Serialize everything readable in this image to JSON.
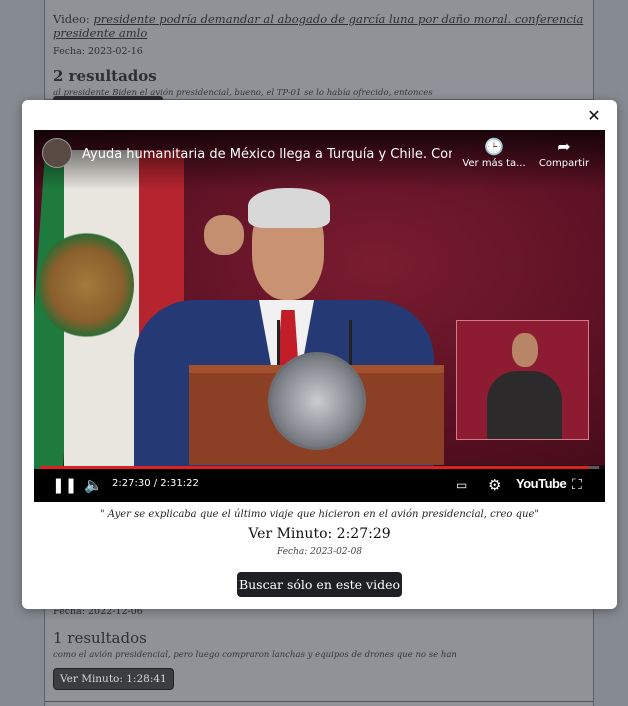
{
  "background": {
    "top_result": {
      "video_label": "Video:",
      "video_link": "presidente podría demandar al abogado de garcía luna por daño moral. conferencia presidente amlo",
      "fecha": "Fecha: 2023-02-16",
      "count": "2 resultados",
      "snippet": "al presidente Biden el avión presidencial, bueno, el TP-01 se lo había ofrecido, entonces"
    },
    "bottom_result": {
      "fecha": "Fecha: 2022-12-06",
      "count": "1 resultados",
      "snippet": "como el avión presidencial, pero luego compraron lanchas y equipos de drones que no se han",
      "minute_button": "Ver Minuto: 1:28:41"
    }
  },
  "modal": {
    "close_glyph": "✕",
    "player": {
      "title": "Ayuda humanitaria de México llega a Turquía y Chile. Conf...",
      "watch_later_label": "Ver más ta...",
      "share_label": "Compartir",
      "time": "2:27:30 / 2:31:22",
      "progress": 0.983,
      "youtube_label": "YouTube",
      "icons": {
        "watch_later": "clock-icon",
        "share": "share-icon",
        "play_pause": "pause-icon",
        "volume": "volume-icon",
        "captions": "captions-icon",
        "settings": "gear-icon",
        "fullscreen": "fullscreen-icon"
      }
    },
    "quote": "\" Ayer se explicaba que el último viaje que hicieron en el avión presidencial, creo que\"",
    "minute": "Ver Minuto: 2:27:29",
    "fecha": "Fecha: 2023-02-08",
    "search_button": "Buscar sólo en este video"
  },
  "colors": {
    "progress_red": "#e02020",
    "button_dark": "#1f2023",
    "overlay": "#868b91"
  }
}
